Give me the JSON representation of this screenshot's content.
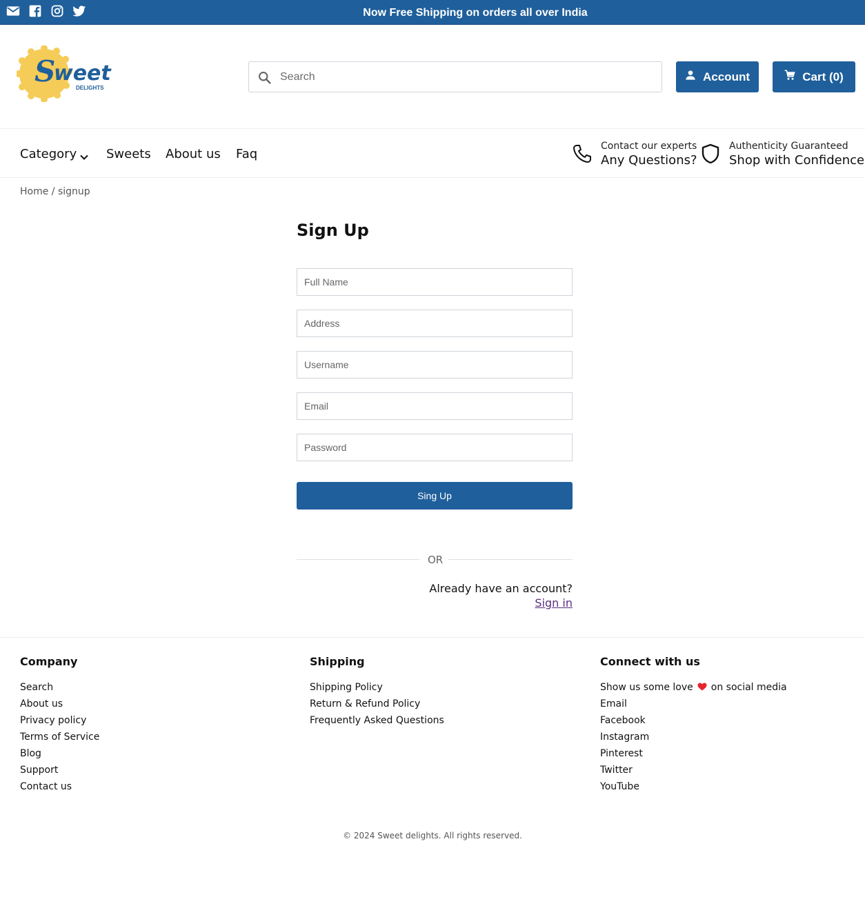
{
  "topbar": {
    "promo": "Now Free Shipping on orders all over India",
    "social_icons": [
      "email-icon",
      "facebook-icon",
      "instagram-icon",
      "twitter-icon"
    ]
  },
  "brand": {
    "logo_text": "Sweet",
    "logo_subtext": "DELIGHTS",
    "primary_color": "#1f5f9b",
    "logo_sun_color": "#f5cc58"
  },
  "header": {
    "search_placeholder": "Search",
    "account_label": "Account",
    "cart_label": "Cart (0)"
  },
  "nav": {
    "items": [
      "Category",
      "Sweets",
      "About us",
      "Faq"
    ],
    "contact_small": "Contact our experts",
    "contact_big": "Any Questions?",
    "auth_small": "Authenticity Guaranteed",
    "auth_big": "Shop with Confidence"
  },
  "breadcrumb": "Home / signup",
  "signup": {
    "title": "Sign Up",
    "fields": [
      {
        "placeholder": "Full Name"
      },
      {
        "placeholder": "Address"
      },
      {
        "placeholder": "Username"
      },
      {
        "placeholder": "Email"
      },
      {
        "placeholder": "Password"
      }
    ],
    "submit_label": "Sing Up",
    "or_text": "OR",
    "already_text": "Already have an account?",
    "signin_link": "Sign in"
  },
  "footer": {
    "company": {
      "title": "Company",
      "links": [
        "Search",
        "About us",
        "Privacy policy",
        "Terms of Service",
        "Blog",
        "Support",
        "Contact us"
      ]
    },
    "shipping": {
      "title": "Shipping",
      "links": [
        "Shipping Policy",
        "Return & Refund Policy",
        "Frequently Asked Questions"
      ]
    },
    "connect": {
      "title": "Connect with us",
      "love_before": "Show us some love",
      "love_after": "on social media",
      "links": [
        "Email",
        "Facebook",
        "Instagram",
        "Pinterest",
        "Twitter",
        "YouTube"
      ]
    },
    "copyright": "© 2024 Sweet delights. All rights reserved."
  }
}
